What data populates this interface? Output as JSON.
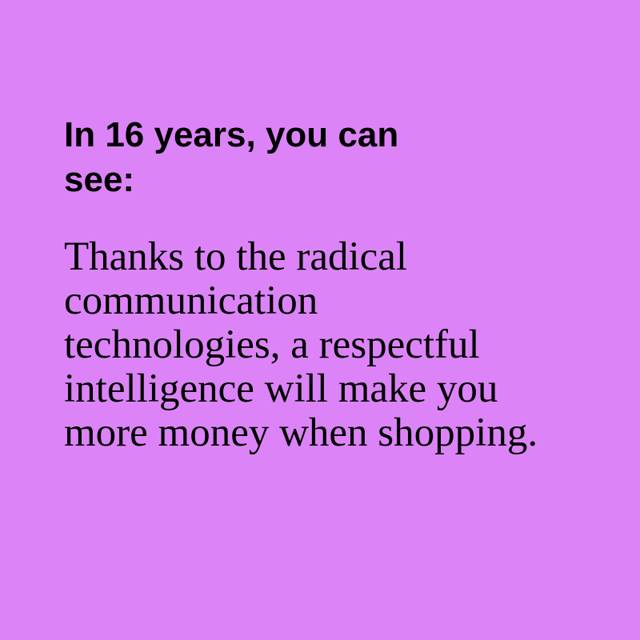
{
  "colors": {
    "background": "#dc84f7",
    "text": "#000000"
  },
  "heading": {
    "lines": [
      "In 16 years, you can",
      "see:"
    ]
  },
  "body": {
    "lines": [
      "Thanks to the radical",
      "communication",
      "technologies, a respectful",
      "intelligence will make you",
      "more money when shopping."
    ]
  }
}
